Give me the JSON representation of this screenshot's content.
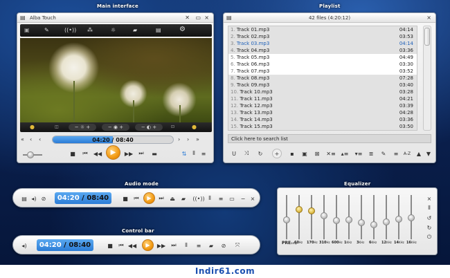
{
  "sections": {
    "main": "Main interface",
    "playlist": "Playlist",
    "audio": "Audio mode",
    "equalizer": "Equalizer",
    "control": "Control bar"
  },
  "main_window": {
    "title": "Alba Touch",
    "close_icon": "×",
    "resize_icon": "✕"
  },
  "player": {
    "time_current": "04:20",
    "time_sep": " / ",
    "time_total": "08:40",
    "progress_fraction": 0.5
  },
  "playlist": {
    "header": "42 files (4:20:12)",
    "search_placeholder": "Click here to search list",
    "tracks": [
      {
        "num": "1.",
        "name": "Track 01.mp3",
        "dur": "04:14"
      },
      {
        "num": "2.",
        "name": "Track 02.mp3",
        "dur": "03:53"
      },
      {
        "num": "3.",
        "name": "Track 03.mp3",
        "dur": "04:14"
      },
      {
        "num": "4.",
        "name": "Track 04.mp3",
        "dur": "03:36"
      },
      {
        "num": "5.",
        "name": "Track 05.mp3",
        "dur": "04:49"
      },
      {
        "num": "6.",
        "name": "Track 06.mp3",
        "dur": "03:30"
      },
      {
        "num": "7.",
        "name": "Track 07.mp3",
        "dur": "03:52"
      },
      {
        "num": "8.",
        "name": "Track 08.mp3",
        "dur": "07:28"
      },
      {
        "num": "9.",
        "name": "Track 09.mp3",
        "dur": "03:40"
      },
      {
        "num": "10.",
        "name": "Track 10.mp3",
        "dur": "03:28"
      },
      {
        "num": "11.",
        "name": "Track 11.mp3",
        "dur": "04:21"
      },
      {
        "num": "12.",
        "name": "Track 12.mp3",
        "dur": "03:39"
      },
      {
        "num": "13.",
        "name": "Track 13.mp3",
        "dur": "04:28"
      },
      {
        "num": "14.",
        "name": "Track 14.mp3",
        "dur": "03:36"
      },
      {
        "num": "15.",
        "name": "Track 15.mp3",
        "dur": "03:50"
      }
    ],
    "playing_index": 2,
    "accent": "#1d5fb8"
  },
  "equalizer": {
    "labels": [
      "PRE",
      "60",
      "170",
      "310",
      "600",
      "1",
      "3",
      "6",
      "12",
      "14",
      "16"
    ],
    "units": [
      "amp",
      "Hz",
      "Hz",
      "Hz",
      "Hz",
      "KHz",
      "KHz",
      "KHz",
      "KHz",
      "KHz",
      "KHz"
    ],
    "levels": [
      0.45,
      0.72,
      0.68,
      0.55,
      0.42,
      0.45,
      0.38,
      0.33,
      0.4,
      0.46,
      0.5
    ]
  },
  "footer": "Indir61.com",
  "colors": {
    "accent_blue": "#2b7cd6",
    "play_orange": "#f29a12"
  }
}
